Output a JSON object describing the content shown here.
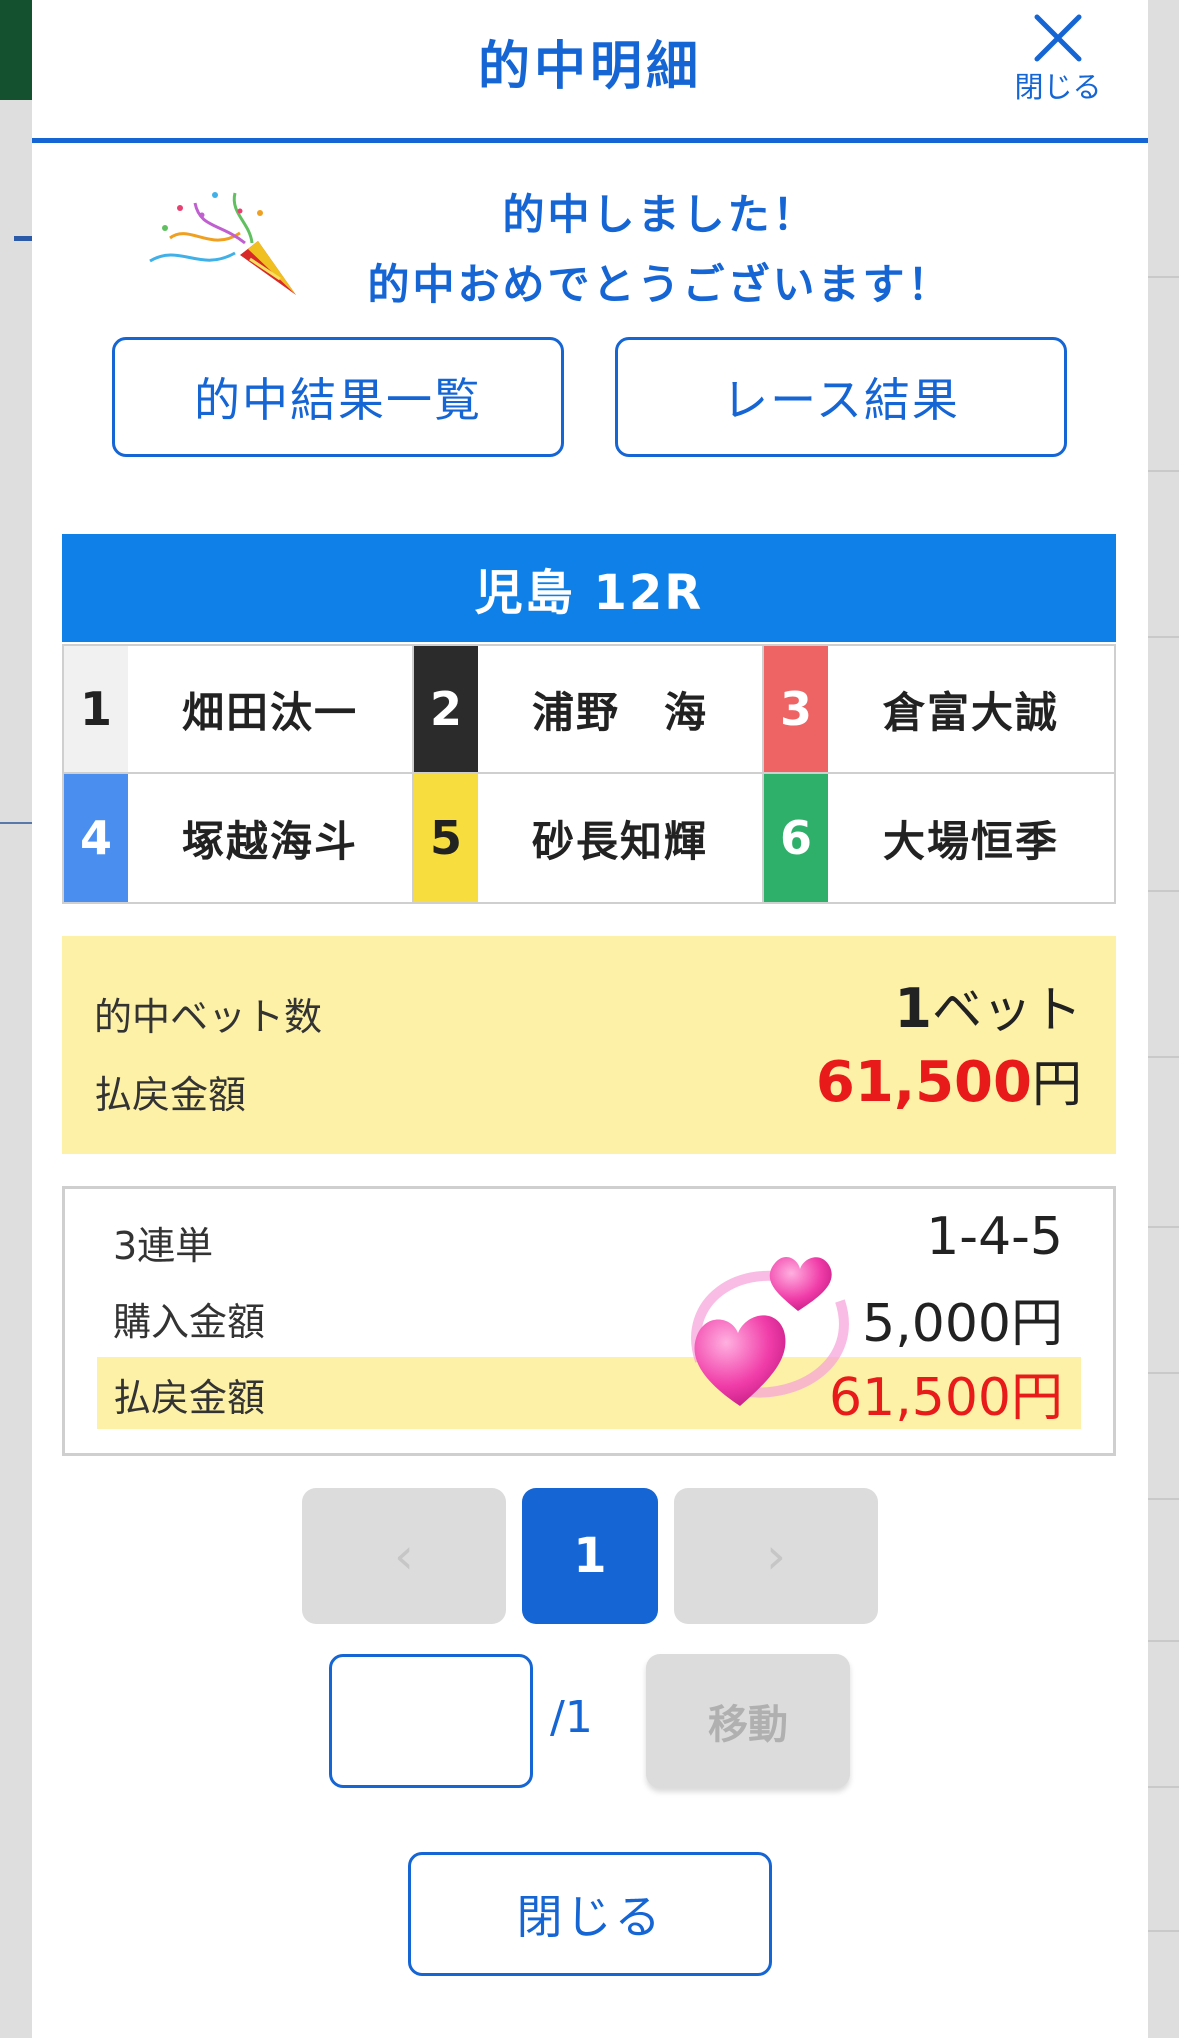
{
  "header": {
    "title": "的中明細",
    "close_label": "閉じる"
  },
  "congrats": {
    "line1": "的中しました！",
    "line2": "的中おめでとうございます！"
  },
  "buttons": {
    "hit_list": "的中結果一覧",
    "race_result": "レース結果"
  },
  "race": {
    "title": "児島 12R"
  },
  "racers": [
    {
      "num": "1",
      "name": "畑田汰一",
      "bg": "#f1f1f1",
      "fg": "#222222"
    },
    {
      "num": "2",
      "name": "浦野　海",
      "bg": "#2b2b2b",
      "fg": "#ffffff"
    },
    {
      "num": "3",
      "name": "倉富大誠",
      "bg": "#ee6464",
      "fg": "#ffffff"
    },
    {
      "num": "4",
      "name": "塚越海斗",
      "bg": "#4a8ff0",
      "fg": "#ffffff"
    },
    {
      "num": "5",
      "name": "砂長知輝",
      "bg": "#f7de3e",
      "fg": "#222222"
    },
    {
      "num": "6",
      "name": "大場恒季",
      "bg": "#2fb06a",
      "fg": "#ffffff"
    }
  ],
  "summary": {
    "bets_label": "的中ベット数",
    "bets_count": "1",
    "bets_unit": "ベット",
    "payout_label": "払戻金額",
    "payout_amount": "61,500",
    "payout_unit": "円"
  },
  "detail": {
    "type_label": "3連単",
    "combination": "1-4-5",
    "purchase_label": "購入金額",
    "purchase_amount": "5,000円",
    "payout_label": "払戻金額",
    "payout_amount": "61,500円"
  },
  "pagination": {
    "prev": "‹",
    "current": "1",
    "next": "›",
    "total": "/1",
    "move_label": "移動",
    "input_value": ""
  },
  "footer": {
    "close_label": "閉じる"
  },
  "colors": {
    "accent": "#1565d4",
    "race_header": "#0f80e8",
    "highlight": "#fcf1a6",
    "payout_red": "#e81a1a"
  }
}
